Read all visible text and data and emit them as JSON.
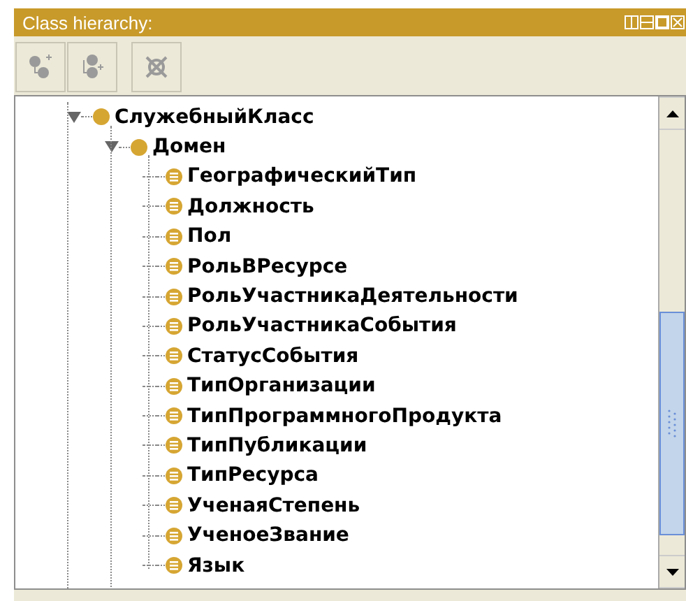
{
  "panel": {
    "title": "Class hierarchy:"
  },
  "toolbar": [
    {
      "kind": "add-subclass",
      "disabled": true
    },
    {
      "kind": "add-sibling",
      "disabled": true
    },
    {
      "kind": "delete",
      "disabled": true
    }
  ],
  "tree": [
    {
      "label": "СлужебныйКласс",
      "kind": "primitive",
      "expanded": true,
      "children": [
        {
          "label": "Домен",
          "kind": "primitive",
          "expanded": true,
          "children": [
            {
              "label": "ГеографическийТип",
              "kind": "defined"
            },
            {
              "label": "Должность",
              "kind": "defined"
            },
            {
              "label": "Пол",
              "kind": "defined"
            },
            {
              "label": "РольВРесурсе",
              "kind": "defined"
            },
            {
              "label": "РольУчастникаДеятельности",
              "kind": "defined"
            },
            {
              "label": "РольУчастникаСобытия",
              "kind": "defined"
            },
            {
              "label": "СтатусСобытия",
              "kind": "defined"
            },
            {
              "label": "ТипОрганизации",
              "kind": "defined"
            },
            {
              "label": "ТипПрограммногоПродукта",
              "kind": "defined"
            },
            {
              "label": "ТипПубликации",
              "kind": "defined"
            },
            {
              "label": "ТипРесурса",
              "kind": "defined"
            },
            {
              "label": "УченаяСтепень",
              "kind": "defined"
            },
            {
              "label": "УченоеЗвание",
              "kind": "defined"
            },
            {
              "label": "Язык",
              "kind": "defined"
            }
          ]
        }
      ]
    }
  ]
}
